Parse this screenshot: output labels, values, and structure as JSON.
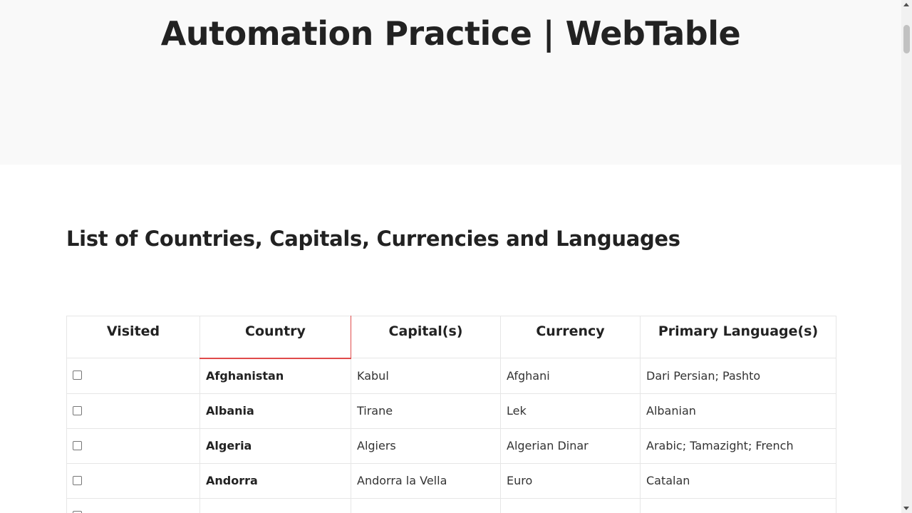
{
  "header": {
    "title": "Automation Practice | WebTable"
  },
  "section": {
    "title": "List of Countries, Capitals, Currencies and Languages"
  },
  "table": {
    "columns": [
      "Visited",
      "Country",
      "Capital(s)",
      "Currency",
      "Primary Language(s)"
    ],
    "rows": [
      {
        "visited": false,
        "country": "Afghanistan",
        "capital": "Kabul",
        "currency": "Afghani",
        "language": "Dari Persian; Pashto"
      },
      {
        "visited": false,
        "country": "Albania",
        "capital": "Tirane",
        "currency": "Lek",
        "language": "Albanian"
      },
      {
        "visited": false,
        "country": "Algeria",
        "capital": "Algiers",
        "currency": "Algerian Dinar",
        "language": "Arabic; Tamazight; French"
      },
      {
        "visited": false,
        "country": "Andorra",
        "capital": "Andorra la Vella",
        "currency": "Euro",
        "language": "Catalan"
      }
    ]
  },
  "colors": {
    "hero_background": "#f9f9f9",
    "active_header_border": "#e04b4b"
  }
}
